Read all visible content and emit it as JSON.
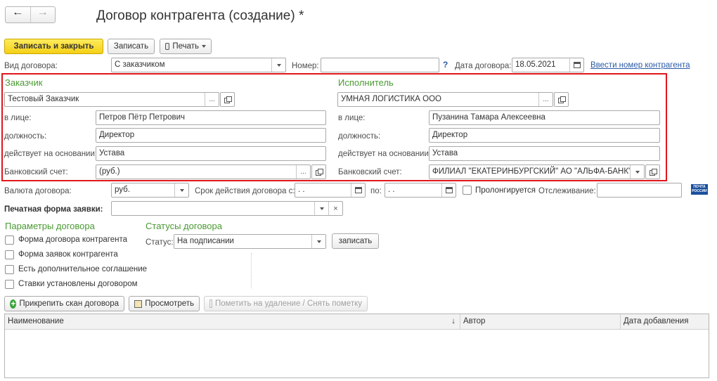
{
  "window": {
    "title": "Договор контрагента (создание) *"
  },
  "toolbar": {
    "save_close": "Записать и закрыть",
    "save": "Записать",
    "print": "Печать"
  },
  "header_row": {
    "contract_type_label": "Вид договора:",
    "contract_type_value": "С заказчиком",
    "number_label": "Номер:",
    "number_value": "",
    "help_mark": "?",
    "date_label": "Дата договора:",
    "date_value": "18.05.2021",
    "enter_number_link": "Ввести номер контрагента"
  },
  "customer": {
    "title": "Заказчик",
    "name": "Тестовый Заказчик",
    "person_label": "в лице:",
    "person_value": "Петров Пётр Петрович",
    "position_label": "должность:",
    "position_value": "Директор",
    "basis_label": "действует на основании:",
    "basis_value": "Устава",
    "bank_label": "Банковский счет:",
    "bank_value": "(руб.)"
  },
  "executor": {
    "title": "Исполнитель",
    "name": "УМНАЯ ЛОГИСТИКА ООО",
    "person_label": "в лице:",
    "person_value": "Пузанина Тамара Алексеевна",
    "position_label": "должность:",
    "position_value": "Директор",
    "basis_label": "действует на основании:",
    "basis_value": "Устава",
    "bank_label": "Банковский счет:",
    "bank_value": "ФИЛИАЛ \"ЕКАТЕРИНБУРГСКИЙ\" АО \"АЛЬФА-БАНК\""
  },
  "terms_row": {
    "currency_label": "Валюта договора:",
    "currency_value": "руб.",
    "period_label": "Срок действия договора с:",
    "period_from": " .  .",
    "to_label": "по:",
    "period_to": " .  .",
    "prolong_label": "Пролонгируется",
    "tracking_label": "Отслеживание:",
    "tracking_value": "",
    "post_logo_line1": "ПОЧТА",
    "post_logo_line2": "РОССИИ"
  },
  "print_form": {
    "label": "Печатная форма заявки:",
    "value": ""
  },
  "params": {
    "title": "Параметры договора",
    "items": [
      "Форма договора контрагента",
      "Форма заявок контрагента",
      "Есть дополнительное соглашение",
      "Ставки установлены договором"
    ]
  },
  "statuses": {
    "title": "Статусы договора",
    "status_label": "Статус:",
    "status_value": "На подписании",
    "save_button": "записать"
  },
  "attachments": {
    "attach_button": "Прикрепить скан договора",
    "view_button": "Просмотреть",
    "mark_delete_button": "Пометить на удаление / Снять пометку",
    "columns": [
      "Наименование",
      "Автор",
      "Дата добавления"
    ],
    "sort_indicator": "↓"
  },
  "colors": {
    "section_title": "#4a9a33",
    "highlight_frame": "#e0161b",
    "primary_button": "#f4cf16",
    "link": "#2a5ba8"
  }
}
